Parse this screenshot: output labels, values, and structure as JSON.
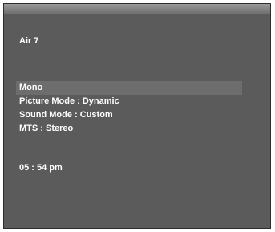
{
  "osd": {
    "channel": "Air  7",
    "info_rows": [
      "Mono",
      "Picture Mode : Dynamic",
      "Sound Mode : Custom",
      "MTS : Stereo"
    ],
    "time": "05 : 54 pm"
  }
}
